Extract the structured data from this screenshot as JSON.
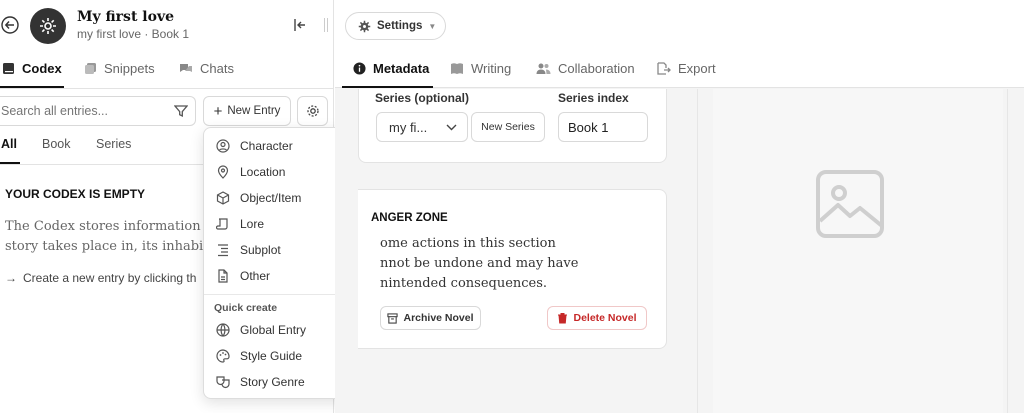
{
  "header": {
    "title": "My first love",
    "subtitle": "my first love · Book 1"
  },
  "left_tabs": [
    "Codex",
    "Snippets",
    "Chats"
  ],
  "search": {
    "placeholder": "Search all entries..."
  },
  "new_entry_label": "New Entry",
  "filter_tabs": [
    "All",
    "Book",
    "Series"
  ],
  "empty": {
    "heading": "YOUR CODEX IS EMPTY",
    "line1": "The Codex stores information abo",
    "line2": "story takes place in, its inhabitant",
    "hint": "Create a new entry by clicking th"
  },
  "menu": {
    "items": [
      "Character",
      "Location",
      "Object/Item",
      "Lore",
      "Subplot",
      "Other"
    ],
    "quick_heading": "Quick create",
    "quick_items": [
      "Global Entry",
      "Style Guide",
      "Story Genre"
    ]
  },
  "settings_label": "Settings",
  "right_tabs": [
    "Metadata",
    "Writing",
    "Collaboration",
    "Export"
  ],
  "series": {
    "label": "Series (optional)",
    "select_value": "my fi...",
    "new_series": "New Series",
    "index_label": "Series index",
    "index_value": "Book 1"
  },
  "danger": {
    "heading": "ANGER ZONE",
    "line1": "ome actions in this section",
    "line2": "nnot be undone and may have",
    "line3": "nintended consequences.",
    "archive": "Archive Novel",
    "delete": "Delete Novel"
  },
  "colors": {
    "accent": "#111111",
    "danger": "#c62828"
  }
}
